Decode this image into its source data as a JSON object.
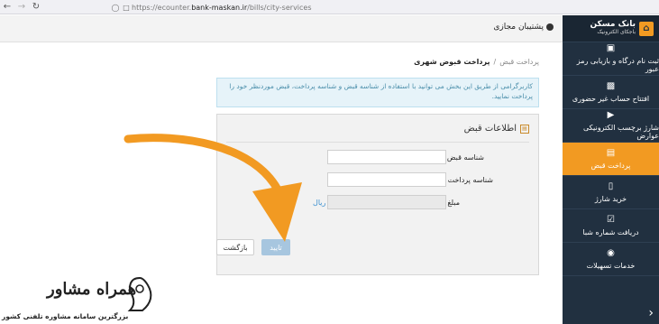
{
  "browser": {
    "url_prefix": "https://ecounter.",
    "url_host": "bank-maskan.ir",
    "url_path": "/bills/city-services"
  },
  "header": {
    "support_label": "پشتیبان مجازی"
  },
  "sidebar": {
    "brand_title": "بانک مسکن",
    "brand_subtitle": "باجکای الکترونیک",
    "items": [
      {
        "label": "ثبت نام درگاه و بازیابی رمز عبور",
        "icon": "user-register-icon"
      },
      {
        "label": "افتتاح حساب غیر حضوری",
        "icon": "briefcase-icon"
      },
      {
        "label": "شارژ برچسب الکترونیکی عوارض",
        "icon": "car-icon"
      },
      {
        "label": "پرداخت قبض",
        "icon": "bill-icon"
      },
      {
        "label": "خرید شارژ",
        "icon": "sim-card-icon"
      },
      {
        "label": "دریافت شماره شبا",
        "icon": "document-check-icon"
      },
      {
        "label": "خدمات تسهیلات",
        "icon": "hand-coin-icon"
      }
    ],
    "active_index": 3
  },
  "breadcrumb": {
    "parent": "پرداخت قبض",
    "separator": "/",
    "current": "پرداخت قبوض شهری"
  },
  "info_message": "کاربرگرامی از طریق این بخش می توانید با استفاده از شناسه قبض و شناسه پرداخت، قبض موردنظر خود را پرداخت نمایید.",
  "form": {
    "title": "اطلاعات قبض",
    "bill_id_label": "شناسه قبض",
    "bill_id_value": "",
    "payment_id_label": "شناسه پرداخت",
    "payment_id_value": "",
    "amount_label": "مبلغ",
    "amount_value": "",
    "amount_unit": "ریال"
  },
  "buttons": {
    "confirm": "تایید",
    "back": "بازگشت"
  },
  "watermark": {
    "title": "همراه مشاور",
    "subtitle": "بزرگترین سامانه مشاوره تلفنی کشور"
  },
  "colors": {
    "sidebar_bg": "#213040",
    "accent": "#f29a22",
    "info_bg": "#e6f3f9"
  }
}
